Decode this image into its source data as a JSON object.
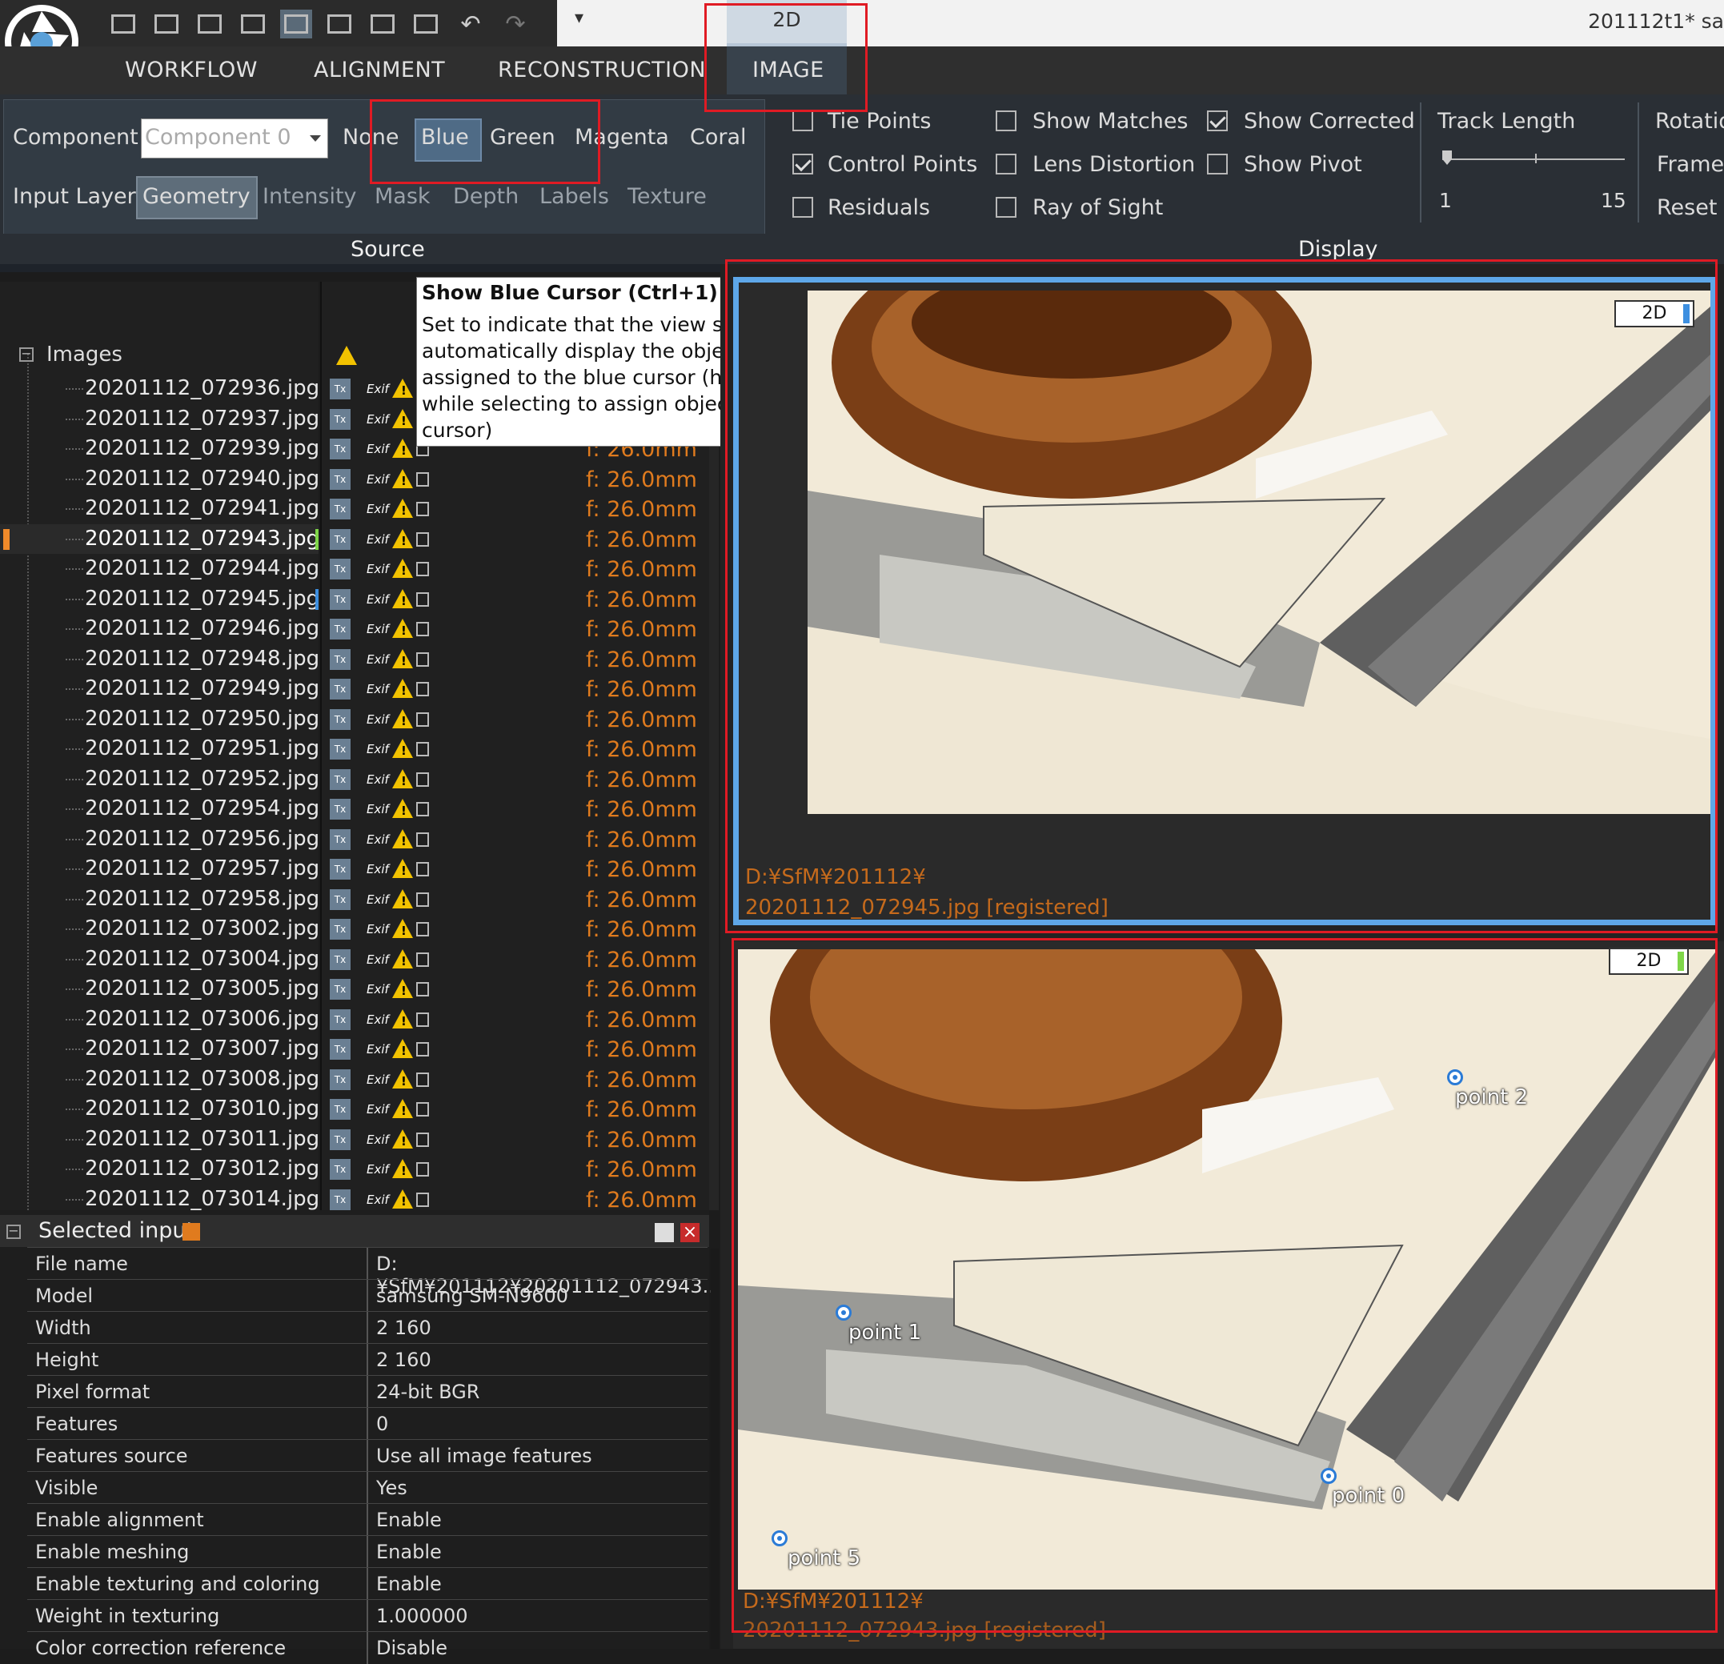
{
  "window": {
    "title": "201112t1* sa",
    "active_tab": "2D",
    "quick_menu": "▾"
  },
  "menu": [
    "WORKFLOW",
    "ALIGNMENT",
    "RECONSTRUCTION",
    "IMAGE"
  ],
  "source": {
    "group_label": "Source",
    "component_label": "Component",
    "component_placeholder": "Component 0",
    "cursor_options": [
      "None",
      "Blue",
      "Green",
      "Magenta",
      "Coral"
    ],
    "selected_cursor": "Blue",
    "input_layer_label": "Input Layer",
    "layers": [
      "Geometry",
      "Intensity",
      "Mask",
      "Depth",
      "Labels",
      "Texture"
    ],
    "selected_layer": "Geometry"
  },
  "display": {
    "group_label": "Display",
    "checkboxes": [
      {
        "label": "Tie Points",
        "checked": false
      },
      {
        "label": "Control Points",
        "checked": true
      },
      {
        "label": "Residuals",
        "checked": false
      },
      {
        "label": "Show Matches",
        "checked": false
      },
      {
        "label": "Lens Distortion",
        "checked": false
      },
      {
        "label": "Ray of Sight",
        "checked": false
      },
      {
        "label": "Show Corrected",
        "checked": true
      },
      {
        "label": "Show Pivot",
        "checked": false
      }
    ],
    "track_length_label": "Track Length",
    "track_min": "1",
    "track_max": "15",
    "track_value": 0.0,
    "right_items": [
      "Rotatio",
      "Frame",
      "Reset V"
    ]
  },
  "tooltip": {
    "title": "Show Blue Cursor (Ctrl+1)",
    "body": "Set to indicate that the view should automatically display the object assigned to the blue cursor (hold 1 while selecting to assign object to the cursor)"
  },
  "tree": {
    "root": "Images",
    "files": [
      "20201112_072936.jpg",
      "20201112_072937.jpg",
      "20201112_072939.jpg",
      "20201112_072940.jpg",
      "20201112_072941.jpg",
      "20201112_072943.jpg",
      "20201112_072944.jpg",
      "20201112_072945.jpg",
      "20201112_072946.jpg",
      "20201112_072948.jpg",
      "20201112_072949.jpg",
      "20201112_072950.jpg",
      "20201112_072951.jpg",
      "20201112_072952.jpg",
      "20201112_072954.jpg",
      "20201112_072956.jpg",
      "20201112_072957.jpg",
      "20201112_072958.jpg",
      "20201112_073002.jpg",
      "20201112_073004.jpg",
      "20201112_073005.jpg",
      "20201112_073006.jpg",
      "20201112_073007.jpg",
      "20201112_073008.jpg",
      "20201112_073010.jpg",
      "20201112_073011.jpg",
      "20201112_073012.jpg",
      "20201112_073014.jpg"
    ],
    "selected_file": "20201112_072943.jpg",
    "focal": "f: 26.0mm",
    "tx_icon": "Tx",
    "exif_icon": "Exif",
    "warn_icon": "!"
  },
  "selected_input": {
    "title": "Selected input",
    "rows": [
      {
        "key": "File name",
        "value": "D:¥SfM¥201112¥20201112_072943...."
      },
      {
        "key": "Model",
        "value": "samsung SM-N9600"
      },
      {
        "key": "Width",
        "value": "2 160"
      },
      {
        "key": "Height",
        "value": "2 160"
      },
      {
        "key": "Pixel format",
        "value": "24-bit BGR"
      },
      {
        "key": "Features",
        "value": "0"
      },
      {
        "key": "Features source",
        "value": "Use all image features"
      },
      {
        "key": "Visible",
        "value": "Yes"
      },
      {
        "key": "Enable alignment",
        "value": "Enable"
      },
      {
        "key": "Enable meshing",
        "value": "Enable"
      },
      {
        "key": "Enable texturing and coloring",
        "value": "Enable"
      },
      {
        "key": "Weight in texturing",
        "value": "1.000000"
      },
      {
        "key": "Color correction reference",
        "value": "Disable"
      }
    ]
  },
  "viewports": [
    {
      "badge": "2D",
      "cursor_color": "#3d8fe0",
      "path_dir": "D:¥SfM¥201112¥",
      "path_file": "20201112_072945.jpg [registered]"
    },
    {
      "badge": "2D",
      "cursor_color": "#7fd648",
      "path_dir": "D:¥SfM¥201112¥",
      "path_file": "20201112_072943.jpg [registered]",
      "points": [
        "point 2",
        "point 1",
        "point 0",
        "point 5"
      ]
    }
  ],
  "colors": {
    "accent_blue": "#5ea7e8",
    "highlight_red": "#e01b24",
    "focal_orange": "#e07b1e"
  }
}
